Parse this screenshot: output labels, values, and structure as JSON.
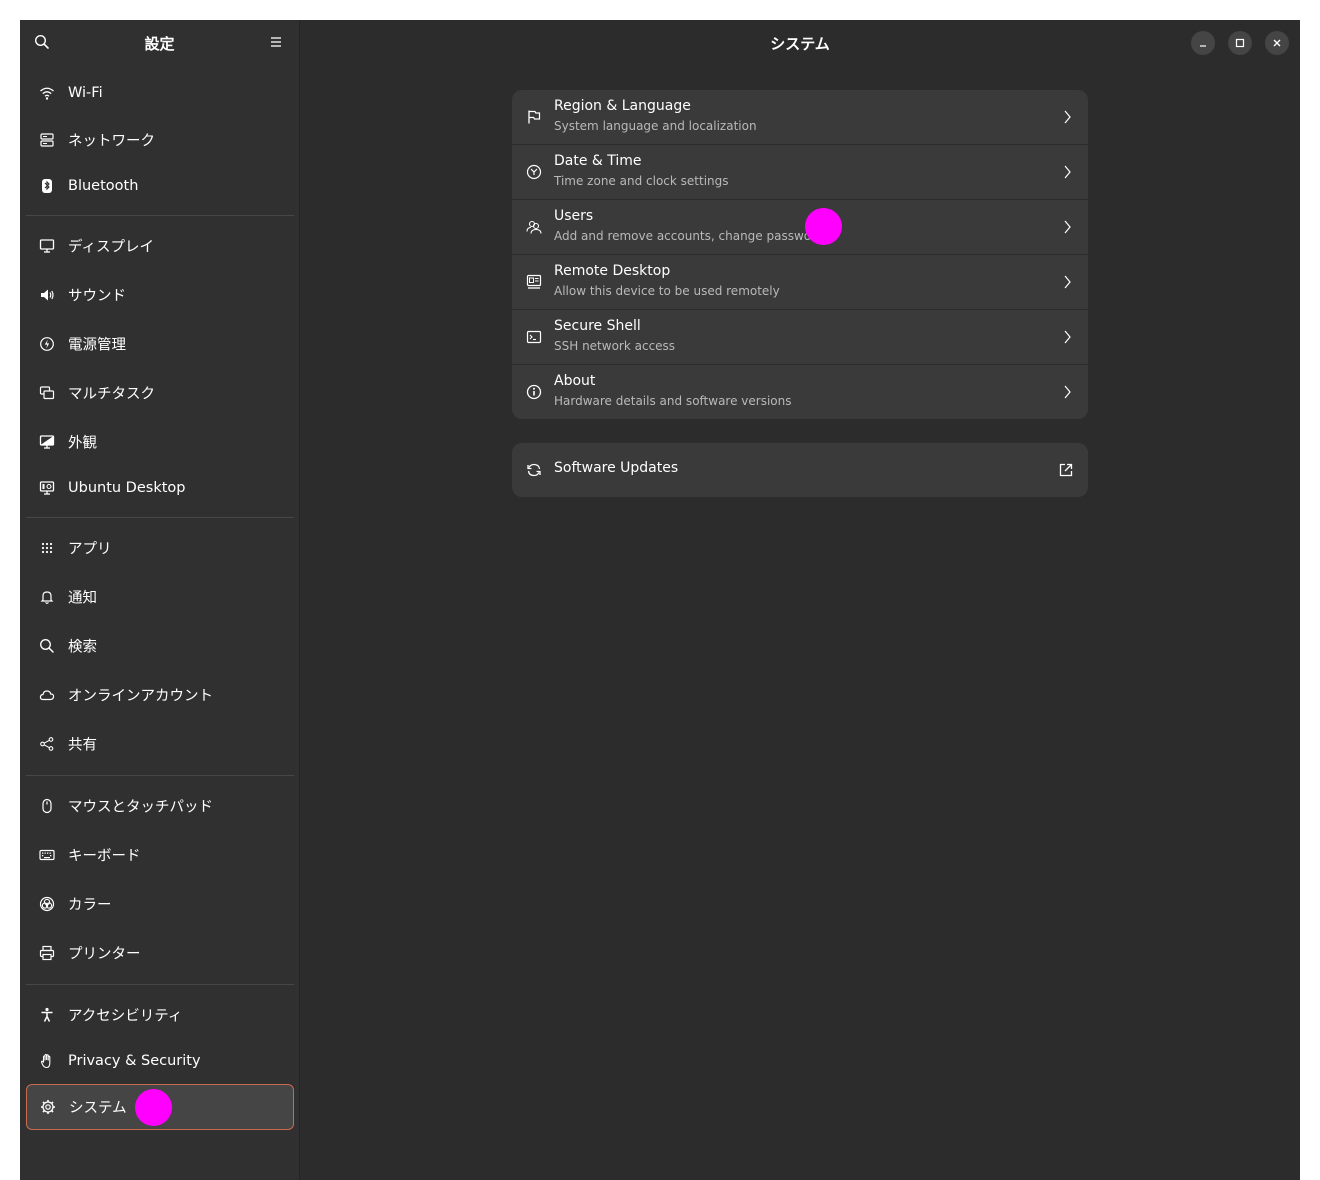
{
  "sidebar": {
    "title": "設定",
    "search_icon": "search-icon",
    "menu_icon": "hamburger-menu-icon",
    "items": [
      {
        "label": "Wi-Fi",
        "icon": "wifi-icon"
      },
      {
        "label": "ネットワーク",
        "icon": "network-icon"
      },
      {
        "label": "Bluetooth",
        "icon": "bluetooth-icon"
      },
      {
        "label": "ディスプレイ",
        "icon": "display-icon"
      },
      {
        "label": "サウンド",
        "icon": "speaker-icon"
      },
      {
        "label": "電源管理",
        "icon": "power-icon"
      },
      {
        "label": "マルチタスク",
        "icon": "multitasking-icon"
      },
      {
        "label": "外観",
        "icon": "appearance-icon"
      },
      {
        "label": "Ubuntu Desktop",
        "icon": "ubuntu-desktop-icon"
      },
      {
        "label": "アプリ",
        "icon": "apps-grid-icon"
      },
      {
        "label": "通知",
        "icon": "bell-icon"
      },
      {
        "label": "検索",
        "icon": "search-icon"
      },
      {
        "label": "オンラインアカウント",
        "icon": "cloud-icon"
      },
      {
        "label": "共有",
        "icon": "share-icon"
      },
      {
        "label": "マウスとタッチパッド",
        "icon": "mouse-icon"
      },
      {
        "label": "キーボード",
        "icon": "keyboard-icon"
      },
      {
        "label": "カラー",
        "icon": "color-icon"
      },
      {
        "label": "プリンター",
        "icon": "printer-icon"
      },
      {
        "label": "アクセシビリティ",
        "icon": "accessibility-icon"
      },
      {
        "label": "Privacy & Security",
        "icon": "hand-icon"
      },
      {
        "label": "システム",
        "icon": "gear-icon",
        "selected": true
      }
    ]
  },
  "main": {
    "title": "システム",
    "rows": [
      {
        "title": "Region & Language",
        "subtitle": "System language and localization",
        "icon": "flag-icon"
      },
      {
        "title": "Date & Time",
        "subtitle": "Time zone and clock settings",
        "icon": "clock-icon"
      },
      {
        "title": "Users",
        "subtitle": "Add and remove accounts, change password",
        "icon": "users-icon"
      },
      {
        "title": "Remote Desktop",
        "subtitle": "Allow this device to be used remotely",
        "icon": "remote-desktop-icon"
      },
      {
        "title": "Secure Shell",
        "subtitle": "SSH network access",
        "icon": "terminal-icon"
      },
      {
        "title": "About",
        "subtitle": "Hardware details and software versions",
        "icon": "info-icon"
      }
    ],
    "updates": {
      "title": "Software Updates",
      "icon": "refresh-icon",
      "action_icon": "external-link-icon"
    }
  },
  "window_controls": [
    "minimize-icon",
    "maximize-icon",
    "close-icon"
  ],
  "colors": {
    "accent_border": "#c86a50",
    "marker": "#ff00ff",
    "background": "#2c2c2c",
    "sidebar": "#303030",
    "card": "#3a3a3a"
  }
}
